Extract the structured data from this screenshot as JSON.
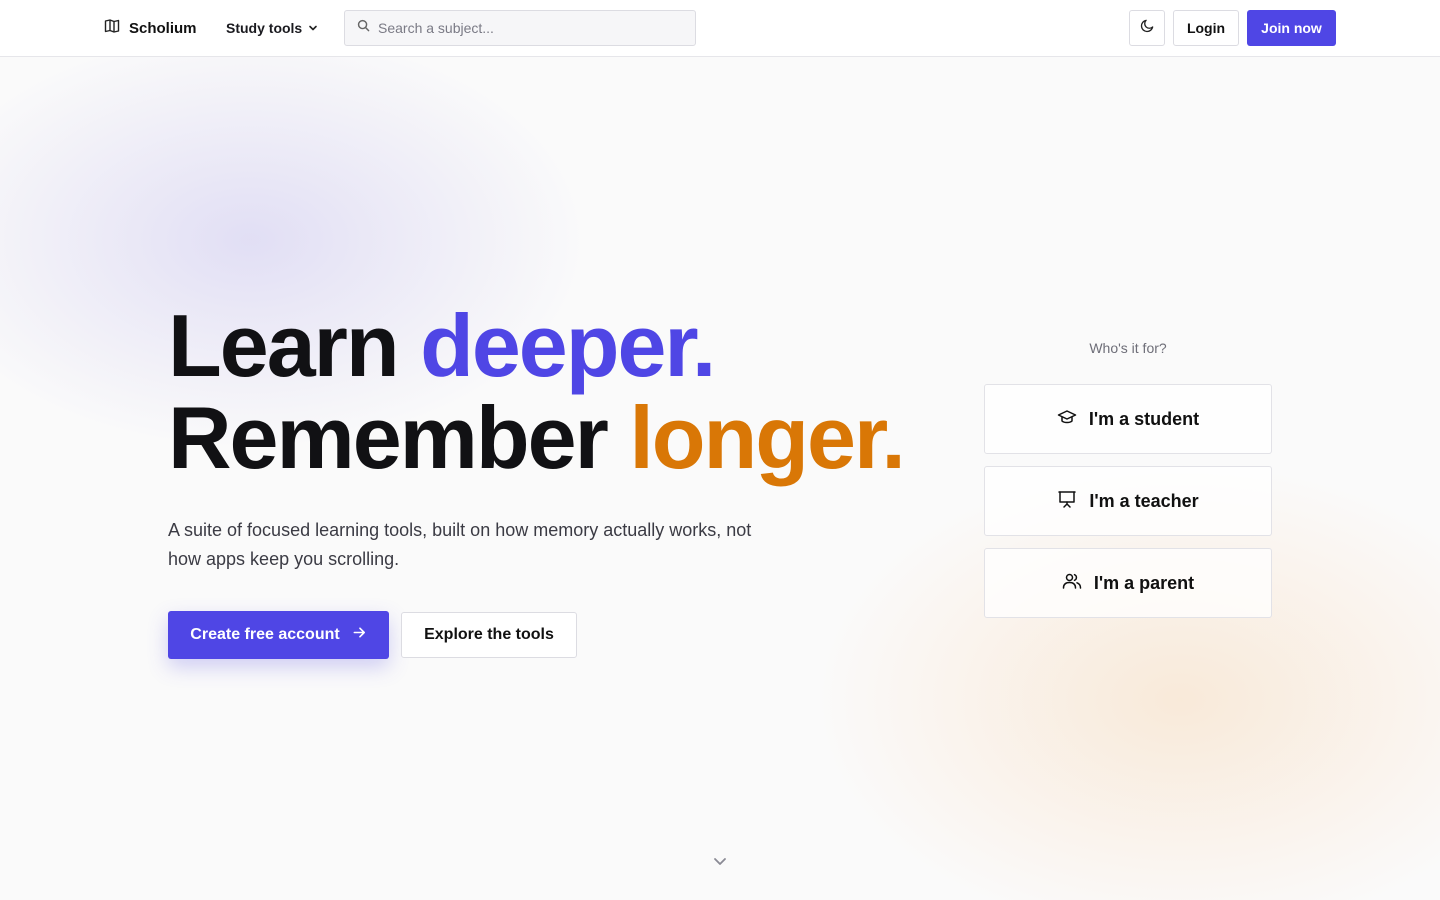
{
  "nav": {
    "brand": "Scholium",
    "study_tools_label": "Study tools",
    "search_placeholder": "Search a subject...",
    "login_label": "Login",
    "join_label": "Join now"
  },
  "hero": {
    "line1_plain": "Learn ",
    "line1_accent": "deeper.",
    "line2_plain": "Remember ",
    "line2_accent": "longer.",
    "subtitle": "A suite of focused learning tools, built on how memory actually works, not how apps keep you scrolling.",
    "primary_cta": "Create free account",
    "secondary_cta": "Explore the tools"
  },
  "audience": {
    "heading": "Who's it for?",
    "options": [
      {
        "label": "I'm a student",
        "icon": "graduation-cap-icon"
      },
      {
        "label": "I'm a teacher",
        "icon": "presentation-board-icon"
      },
      {
        "label": "I'm a parent",
        "icon": "users-icon"
      }
    ]
  },
  "colors": {
    "accent": "#4f46e5",
    "accent_warm": "#d97706",
    "text": "#111114"
  }
}
